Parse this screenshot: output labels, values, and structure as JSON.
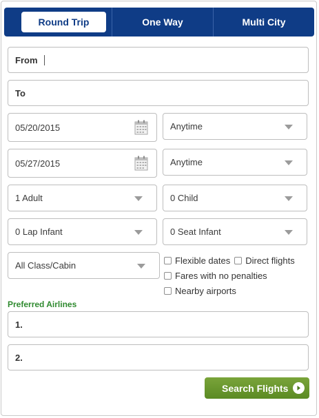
{
  "tabs": {
    "round_trip": "Round Trip",
    "one_way": "One Way",
    "multi_city": "Multi City"
  },
  "from": {
    "label": "From"
  },
  "to": {
    "label": "To"
  },
  "depart": {
    "date": "05/20/2015",
    "time": "Anytime"
  },
  "return": {
    "date": "05/27/2015",
    "time": "Anytime"
  },
  "passengers": {
    "adult": "1 Adult",
    "child": "0 Child",
    "lap_infant": "0 Lap Infant",
    "seat_infant": "0 Seat Infant"
  },
  "cabin": "All Class/Cabin",
  "options": {
    "flexible_dates": "Flexible dates",
    "direct_flights": "Direct flights",
    "no_penalties": "Fares with no penalties",
    "nearby_airports": "Nearby airports"
  },
  "preferred_airlines": {
    "title": "Preferred Airlines",
    "first": "1.",
    "second": "2."
  },
  "search_button": "Search Flights",
  "colors": {
    "tab_bar": "#0f3c86",
    "accent_green": "#2f8a2f",
    "button_green": "#6b9a2c"
  }
}
